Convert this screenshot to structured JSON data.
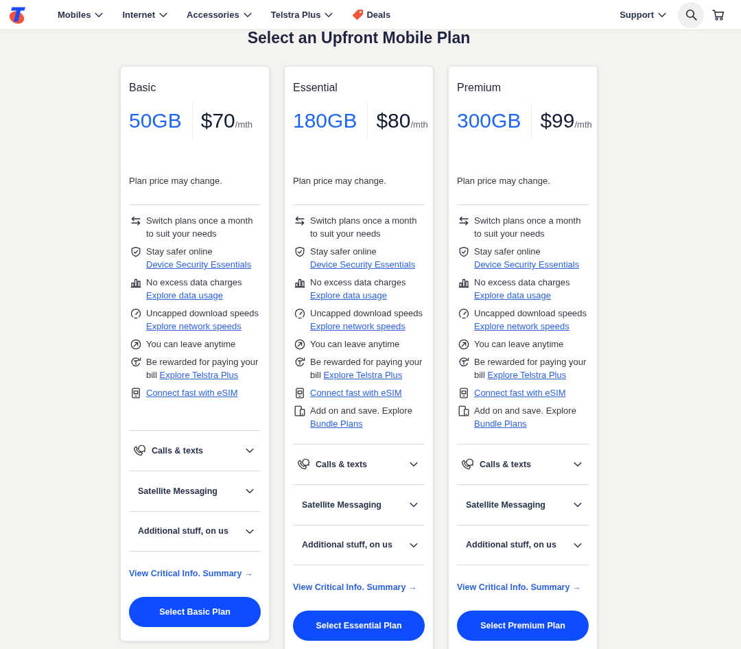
{
  "nav": {
    "items": [
      {
        "label": "Mobiles",
        "kind": "menu"
      },
      {
        "label": "Internet",
        "kind": "menu"
      },
      {
        "label": "Accessories",
        "kind": "menu"
      },
      {
        "label": "Telstra Plus",
        "kind": "menu"
      },
      {
        "label": "Deals",
        "kind": "deal"
      }
    ],
    "support": {
      "label": "Support"
    }
  },
  "heading": "Select an Upfront Mobile Plan",
  "plans": [
    {
      "name": "Basic",
      "data": "50GB",
      "price": "$70",
      "period": "/mth",
      "note": "Plan price may change.",
      "features": [
        {
          "text": "Switch plans once a month to suit your needs"
        },
        {
          "text": "Stay safer online",
          "link_below": "Device Security Essentials"
        },
        {
          "text": "No excess data charges",
          "link_below": "Explore data usage"
        },
        {
          "text": "Uncapped download speeds",
          "link_below": "Explore network speeds"
        },
        {
          "text": "You can leave anytime"
        },
        {
          "text": "Be rewarded for paying your bill",
          "link": "Explore Telstra Plus"
        },
        {
          "link": "Connect fast with eSIM"
        }
      ],
      "sections": [
        {
          "label": "Calls & texts",
          "expanded": false
        },
        {
          "label": "Satellite Messaging",
          "expanded": false
        },
        {
          "label": "Additional stuff, on us",
          "expanded": false
        }
      ],
      "summary_link": "View Critical Info. Summary →",
      "button": "Select Basic Plan"
    },
    {
      "name": "Essential",
      "data": "180GB",
      "price": "$80",
      "period": "/mth",
      "note": "Plan price may change.",
      "features": [
        {
          "text": "Switch plans once a month to suit your needs"
        },
        {
          "text": "Stay safer online",
          "link_below": "Device Security Essentials"
        },
        {
          "text": "No excess data charges",
          "link_below": "Explore data usage"
        },
        {
          "text": "Uncapped download speeds",
          "link_below": "Explore network speeds"
        },
        {
          "text": "You can leave anytime"
        },
        {
          "text": "Be rewarded for paying your bill",
          "link": "Explore Telstra Plus"
        },
        {
          "link": "Connect fast with eSIM"
        },
        {
          "text": "Add on and save. Explore",
          "link": "Bundle Plans"
        }
      ],
      "sections": [
        {
          "label": "Calls & texts",
          "expanded": false
        },
        {
          "label": "Satellite Messaging",
          "expanded": false
        },
        {
          "label": "Additional stuff, on us",
          "expanded": false
        }
      ],
      "summary_link": "View Critical Info. Summary →",
      "button": "Select Essential Plan"
    },
    {
      "name": "Premium",
      "data": "300GB",
      "price": "$99",
      "period": "/mth",
      "note": "Plan price may change.",
      "features": [
        {
          "text": "Switch plans once a month to suit your needs"
        },
        {
          "text": "Stay safer online",
          "link_below": "Device Security Essentials"
        },
        {
          "text": "No excess data charges",
          "link_below": "Explore data usage"
        },
        {
          "text": "Uncapped download speeds",
          "link_below": "Explore network speeds"
        },
        {
          "text": "You can leave anytime"
        },
        {
          "text": "Be rewarded for paying your bill",
          "link": "Explore Telstra Plus"
        },
        {
          "link": "Connect fast with eSIM"
        },
        {
          "text": "Add on and save. Explore",
          "link": "Bundle Plans"
        }
      ],
      "sections": [
        {
          "label": "Calls & texts",
          "expanded": false
        },
        {
          "label": "Satellite Messaging",
          "expanded": false
        },
        {
          "label": "Additional stuff, on us",
          "expanded": false
        }
      ],
      "summary_link": "View Critical Info. Summary →",
      "button": "Select Premium Plan"
    }
  ]
}
